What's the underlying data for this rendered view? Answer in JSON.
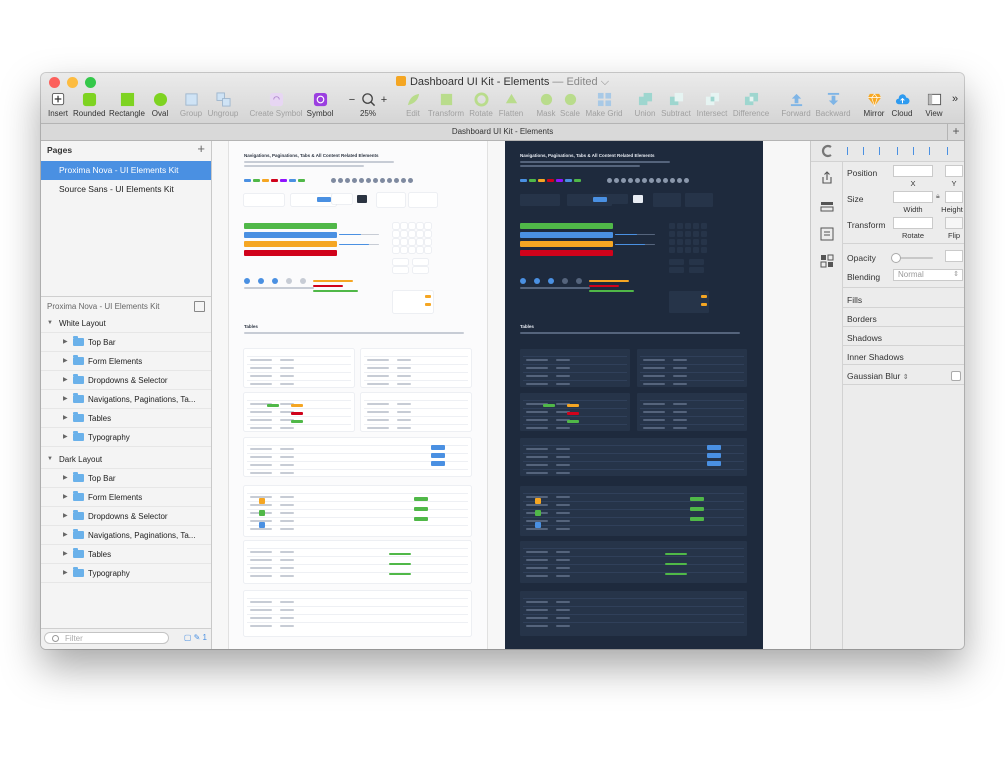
{
  "window": {
    "title": "Dashboard UI Kit - Elements",
    "title_suffix": " — Edited",
    "title_chevron": "⌵"
  },
  "toolbar": {
    "items": [
      {
        "label": "Insert",
        "icon": "plus-icon"
      },
      {
        "label": "Rounded",
        "icon": "rounded-rect-icon"
      },
      {
        "label": "Rectangle",
        "icon": "rectangle-icon"
      },
      {
        "label": "Oval",
        "icon": "oval-icon"
      },
      {
        "label": "Group",
        "icon": "group-icon"
      },
      {
        "label": "Ungroup",
        "icon": "ungroup-icon"
      },
      {
        "label": "Create Symbol",
        "icon": "create-symbol-icon"
      },
      {
        "label": "Symbol",
        "icon": "symbol-icon"
      },
      {
        "label": "25%",
        "icon": "zoom-icon"
      },
      {
        "label": "Edit",
        "icon": "edit-icon"
      },
      {
        "label": "Transform",
        "icon": "transform-icon"
      },
      {
        "label": "Rotate",
        "icon": "rotate-icon"
      },
      {
        "label": "Flatten",
        "icon": "flatten-icon"
      },
      {
        "label": "Mask",
        "icon": "mask-icon"
      },
      {
        "label": "Scale",
        "icon": "scale-icon"
      },
      {
        "label": "Make Grid",
        "icon": "grid-icon"
      },
      {
        "label": "Union",
        "icon": "union-icon"
      },
      {
        "label": "Subtract",
        "icon": "subtract-icon"
      },
      {
        "label": "Intersect",
        "icon": "intersect-icon"
      },
      {
        "label": "Difference",
        "icon": "difference-icon"
      },
      {
        "label": "Forward",
        "icon": "forward-icon"
      },
      {
        "label": "Backward",
        "icon": "backward-icon"
      },
      {
        "label": "Mirror",
        "icon": "mirror-icon"
      },
      {
        "label": "Cloud",
        "icon": "cloud-icon"
      },
      {
        "label": "View",
        "icon": "view-icon"
      }
    ],
    "zoom_minus": "−",
    "zoom_plus": "+",
    "overflow": "»"
  },
  "tabstrip": {
    "title": "Dashboard UI Kit - Elements",
    "add": "+"
  },
  "pages": {
    "header": "Pages",
    "add": "+",
    "items": [
      {
        "label": "Proxima Nova - UI Elements Kit",
        "selected": true
      },
      {
        "label": "Source Sans - UI Elements Kit",
        "selected": false
      }
    ]
  },
  "layers": {
    "header": "Proxima Nova - UI Elements Kit",
    "groups": [
      {
        "label": "White Layout",
        "children": [
          "Top Bar",
          "Form Elements",
          "Dropdowns & Selector",
          "Navigations, Paginations, Ta...",
          "Tables",
          "Typography"
        ]
      },
      {
        "label": "Dark Layout",
        "children": [
          "Top Bar",
          "Form Elements",
          "Dropdowns & Selector",
          "Navigations, Paginations, Ta...",
          "Tables",
          "Typography"
        ]
      }
    ],
    "filter_placeholder": "Filter",
    "filter_count": "1"
  },
  "canvas": {
    "white_title": "Navigations, Paginations, Tabs & All Content Related Elements",
    "dark_title": "Navigations, Paginations, Tabs & All Content Related Elements",
    "tables_label": "Tables"
  },
  "inspector": {
    "position": "Position",
    "x": "X",
    "y": "Y",
    "size": "Size",
    "width": "Width",
    "height": "Height",
    "transform": "Transform",
    "rotate": "Rotate",
    "flip": "Flip",
    "opacity": "Opacity",
    "blending": "Blending",
    "blending_value": "Normal",
    "fills": "Fills",
    "borders": "Borders",
    "shadows": "Shadows",
    "inner_shadows": "Inner Shadows",
    "gaussian_blur": "Gaussian Blur"
  },
  "colors": {
    "selection": "#4a90e2",
    "green": "#7ed321",
    "purple": "#9b3fe0",
    "dark_artboard": "#1e2a3d",
    "folder": "#6ab1ea"
  }
}
